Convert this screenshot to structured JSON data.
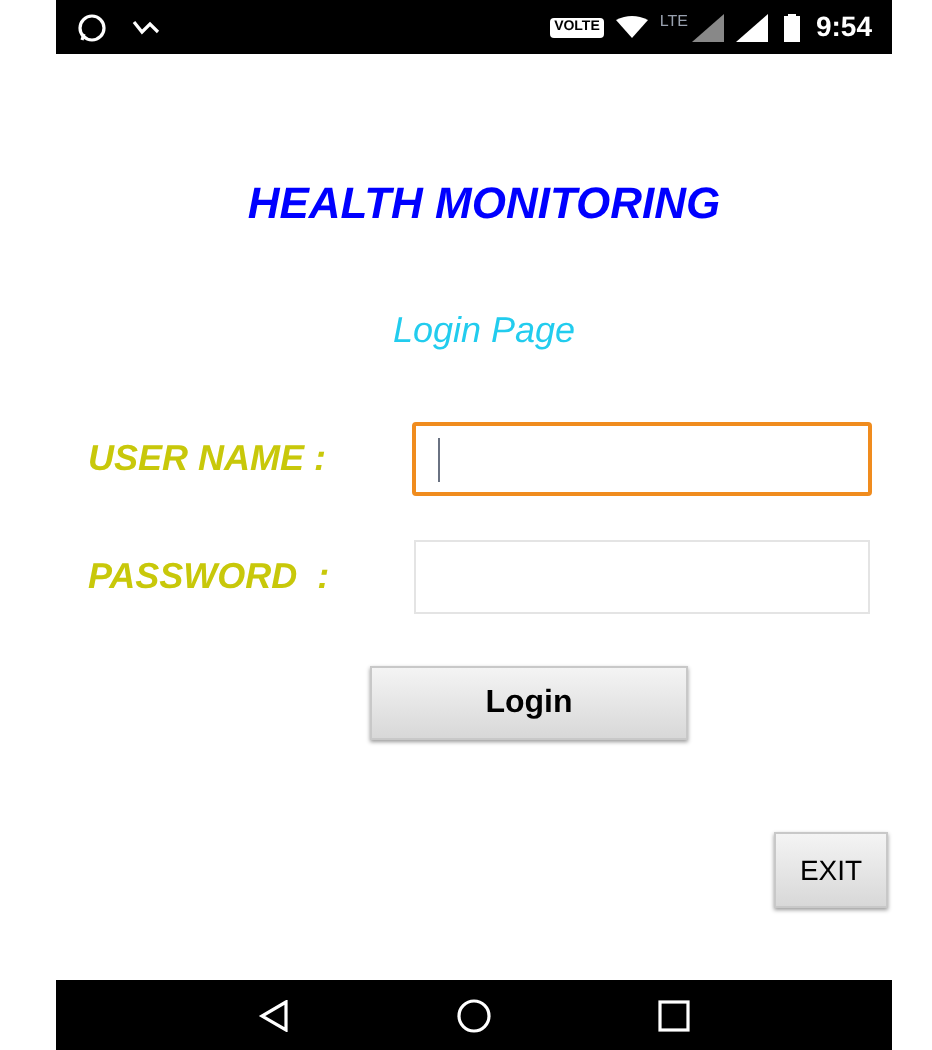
{
  "status_bar": {
    "badge": "VOLTE",
    "network": "LTE",
    "time": "9:54"
  },
  "title": "HEALTH MONITORING",
  "subtitle": "Login Page",
  "fields": [
    {
      "label": "USER NAME :",
      "focused": true
    },
    {
      "label": "PASSWORD  :",
      "focused": false
    }
  ],
  "login_button": "Login",
  "exit_button": "EXIT"
}
